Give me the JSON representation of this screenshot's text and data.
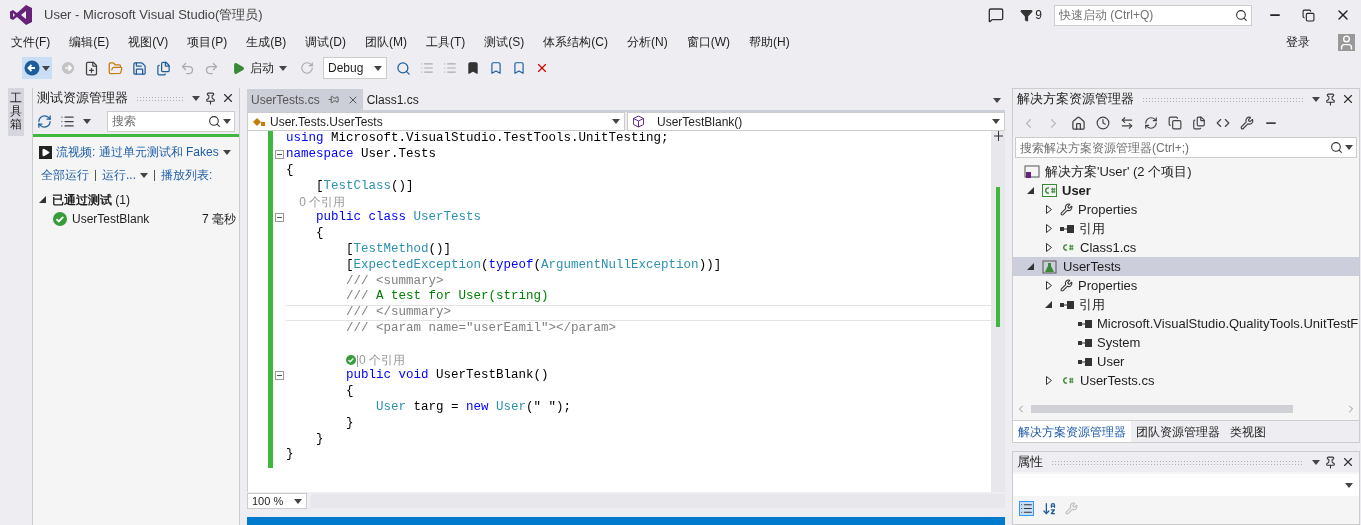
{
  "window": {
    "title": "User - Microsoft Visual Studio(管理员)",
    "notification_count": "9",
    "quick_launch": {
      "placeholder": "快速启动 (Ctrl+Q)"
    },
    "sign_in": "登录"
  },
  "menu": [
    "文件(F)",
    "编辑(E)",
    "视图(V)",
    "项目(P)",
    "生成(B)",
    "调试(D)",
    "团队(M)",
    "工具(T)",
    "测试(S)",
    "体系结构(C)",
    "分析(N)",
    "窗口(W)",
    "帮助(H)"
  ],
  "toolbar": {
    "start": "启动",
    "configuration": "Debug"
  },
  "toolbox_tab": "工具箱",
  "test_explorer": {
    "title": "测试资源管理器",
    "search": {
      "placeholder": "搜索"
    },
    "video_link": "流视频: 通过单元测试和 Fakes",
    "actions": [
      {
        "label": "全部运行",
        "dropdown": false
      },
      {
        "label": "运行...",
        "dropdown": true
      },
      {
        "label": "播放列表:",
        "dropdown": false
      }
    ],
    "groups": [
      {
        "label": "**已通过测试** (1)",
        "expanded": true,
        "tests": [
          {
            "name": "UserTestBlank",
            "duration": "7 毫秒",
            "passed": true
          }
        ]
      }
    ]
  },
  "editor": {
    "tabs": [
      {
        "label": "UserTests.cs",
        "selected": true
      },
      {
        "label": "Class1.cs",
        "selected": false
      }
    ],
    "nav": {
      "type": "User.Tests.UserTests",
      "member": "UserTestBlank()"
    },
    "zoom": "100 %",
    "lines": [
      {
        "foldable": false,
        "current": false,
        "tokens": [
          {
            "kind": "keyword",
            "text": "using"
          },
          {
            "kind": "plain",
            "text": " Microsoft.VisualStudio.TestTools.UnitTesting;"
          }
        ]
      },
      {
        "foldable": true,
        "current": false,
        "tokens": [
          {
            "kind": "keyword",
            "text": "namespace"
          },
          {
            "kind": "plain",
            "text": " User.Tests"
          }
        ]
      },
      {
        "foldable": false,
        "current": false,
        "tokens": [
          {
            "kind": "plain",
            "text": "{"
          }
        ]
      },
      {
        "foldable": false,
        "current": false,
        "tokens": [
          {
            "kind": "plain",
            "text": "    ["
          },
          {
            "kind": "type",
            "text": "TestClass"
          },
          {
            "kind": "plain",
            "text": "()]"
          }
        ]
      },
      {
        "foldable": false,
        "current": false,
        "tokens": [
          {
            "kind": "lens",
            "text": "    0 个引用"
          }
        ]
      },
      {
        "foldable": true,
        "current": false,
        "tokens": [
          {
            "kind": "keyword",
            "text": "    public class "
          },
          {
            "kind": "type",
            "text": "UserTests"
          }
        ]
      },
      {
        "foldable": false,
        "current": false,
        "tokens": [
          {
            "kind": "plain",
            "text": "    {"
          }
        ]
      },
      {
        "foldable": false,
        "current": false,
        "tokens": [
          {
            "kind": "plain",
            "text": "        ["
          },
          {
            "kind": "type",
            "text": "TestMethod"
          },
          {
            "kind": "plain",
            "text": "()]"
          }
        ]
      },
      {
        "foldable": false,
        "current": false,
        "tokens": [
          {
            "kind": "plain",
            "text": "        ["
          },
          {
            "kind": "type",
            "text": "ExpectedException"
          },
          {
            "kind": "plain",
            "text": "("
          },
          {
            "kind": "keyword",
            "text": "typeof"
          },
          {
            "kind": "plain",
            "text": "("
          },
          {
            "kind": "type",
            "text": "ArgumentNullException"
          },
          {
            "kind": "plain",
            "text": "))]"
          }
        ]
      },
      {
        "foldable": false,
        "current": false,
        "tokens": [
          {
            "kind": "doc",
            "text": "        /// <summary>"
          }
        ]
      },
      {
        "foldable": false,
        "current": false,
        "tokens": [
          {
            "kind": "doc",
            "text": "        ///"
          },
          {
            "kind": "comment",
            "text": " A test for User(string)"
          }
        ]
      },
      {
        "foldable": false,
        "current": true,
        "tokens": [
          {
            "kind": "doc",
            "text": "        /// </summary>"
          }
        ]
      },
      {
        "foldable": false,
        "current": false,
        "tokens": [
          {
            "kind": "doc",
            "text": "        /// <param name=\"userEamil\"></param>"
          }
        ]
      },
      {
        "foldable": false,
        "current": false
      },
      {
        "foldable": false,
        "current": false,
        "tokens": [
          {
            "kind": "passed_lens",
            "text": "|0 个引用"
          }
        ]
      },
      {
        "foldable": true,
        "current": false,
        "tokens": [
          {
            "kind": "keyword",
            "text": "        public void"
          },
          {
            "kind": "plain",
            "text": " UserTestBlank()"
          }
        ]
      },
      {
        "foldable": false,
        "current": false,
        "tokens": [
          {
            "kind": "plain",
            "text": "        {"
          }
        ]
      },
      {
        "foldable": false,
        "current": false,
        "tokens": [
          {
            "kind": "type",
            "text": "            User"
          },
          {
            "kind": "plain",
            "text": " targ = "
          },
          {
            "kind": "keyword",
            "text": "new"
          },
          {
            "kind": "type",
            "text": " User"
          },
          {
            "kind": "plain",
            "text": "(\" \");"
          }
        ]
      },
      {
        "foldable": false,
        "current": false,
        "tokens": [
          {
            "kind": "plain",
            "text": "        }"
          }
        ]
      },
      {
        "foldable": false,
        "current": false,
        "tokens": [
          {
            "kind": "plain",
            "text": "    }"
          }
        ]
      },
      {
        "foldable": false,
        "current": false,
        "tokens": [
          {
            "kind": "plain",
            "text": "}"
          }
        ]
      }
    ]
  },
  "solution_explorer": {
    "title": "解决方案资源管理器",
    "search": {
      "placeholder": "搜索解决方案资源管理器(Ctrl+;)"
    },
    "tree": [
      {
        "label": "解决方案'User' (2 个项目)",
        "kind": "solution",
        "bold": false,
        "selected": false,
        "children": [
          {
            "label": "User",
            "kind": "cs_project",
            "bold": true,
            "selected": false,
            "expanded": true,
            "children": [
              {
                "label": "Properties",
                "kind": "properties",
                "bold": false,
                "selected": false,
                "expanded": false
              },
              {
                "label": "引用",
                "kind": "references",
                "bold": false,
                "selected": false,
                "expanded": false
              },
              {
                "label": "Class1.cs",
                "kind": "cs_file",
                "bold": false,
                "selected": false,
                "expanded": false
              }
            ]
          },
          {
            "label": "UserTests",
            "kind": "test_project",
            "bold": false,
            "selected": true,
            "expanded": true,
            "children": [
              {
                "label": "Properties",
                "kind": "properties",
                "bold": false,
                "selected": false,
                "expanded": false
              },
              {
                "label": "引用",
                "kind": "references",
                "bold": false,
                "selected": false,
                "expanded": true,
                "children": [
                  {
                    "label": "Microsoft.VisualStudio.QualityTools.UnitTestF",
                    "kind": "reference",
                    "bold": false,
                    "selected": false
                  },
                  {
                    "label": "System",
                    "kind": "reference",
                    "bold": false,
                    "selected": false
                  },
                  {
                    "label": "User",
                    "kind": "reference",
                    "bold": false,
                    "selected": false
                  }
                ]
              },
              {
                "label": "UserTests.cs",
                "kind": "cs_file",
                "bold": false,
                "selected": false,
                "expanded": false
              }
            ]
          }
        ]
      }
    ],
    "tabs": [
      {
        "label": "解决方案资源管理器",
        "selected": true
      },
      {
        "label": "团队资源管理器",
        "selected": false
      },
      {
        "label": "类视图",
        "selected": false
      }
    ]
  },
  "properties": {
    "title": "属性"
  }
}
